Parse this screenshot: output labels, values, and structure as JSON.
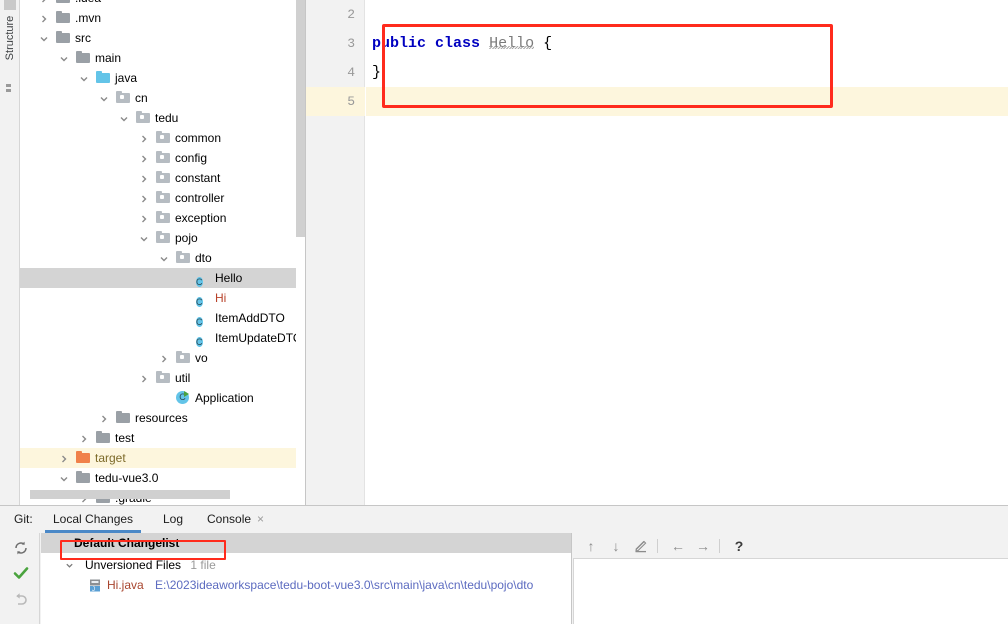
{
  "window": {
    "tool_strip_label": "Structure"
  },
  "project_tree": {
    "rows": [
      {
        "label": ".idea",
        "depth": 1,
        "arrow": "right",
        "icon": "folder",
        "color": "",
        "state": "normal"
      },
      {
        "label": ".mvn",
        "depth": 1,
        "arrow": "right",
        "icon": "folder",
        "color": "",
        "state": "normal"
      },
      {
        "label": "src",
        "depth": 1,
        "arrow": "down",
        "icon": "folder",
        "color": "",
        "state": "normal"
      },
      {
        "label": "main",
        "depth": 2,
        "arrow": "down",
        "icon": "folder",
        "color": "",
        "state": "normal"
      },
      {
        "label": "java",
        "depth": 3,
        "arrow": "down",
        "icon": "folder-blue",
        "color": "",
        "state": "normal"
      },
      {
        "label": "cn",
        "depth": 4,
        "arrow": "down",
        "icon": "package",
        "color": "",
        "state": "normal"
      },
      {
        "label": "tedu",
        "depth": 5,
        "arrow": "down",
        "icon": "package",
        "color": "",
        "state": "normal"
      },
      {
        "label": "common",
        "depth": 6,
        "arrow": "right",
        "icon": "package",
        "color": "",
        "state": "normal"
      },
      {
        "label": "config",
        "depth": 6,
        "arrow": "right",
        "icon": "package",
        "color": "",
        "state": "normal"
      },
      {
        "label": "constant",
        "depth": 6,
        "arrow": "right",
        "icon": "package",
        "color": "",
        "state": "normal"
      },
      {
        "label": "controller",
        "depth": 6,
        "arrow": "right",
        "icon": "package",
        "color": "",
        "state": "normal"
      },
      {
        "label": "exception",
        "depth": 6,
        "arrow": "right",
        "icon": "package",
        "color": "",
        "state": "normal"
      },
      {
        "label": "pojo",
        "depth": 6,
        "arrow": "down",
        "icon": "package",
        "color": "",
        "state": "normal"
      },
      {
        "label": "dto",
        "depth": 7,
        "arrow": "down",
        "icon": "package",
        "color": "",
        "state": "normal"
      },
      {
        "label": "Hello",
        "depth": 8,
        "arrow": "",
        "icon": "class",
        "color": "",
        "state": "selected"
      },
      {
        "label": "Hi",
        "depth": 8,
        "arrow": "",
        "icon": "class",
        "color": "red",
        "state": "normal"
      },
      {
        "label": "ItemAddDTO",
        "depth": 8,
        "arrow": "",
        "icon": "class",
        "color": "",
        "state": "normal"
      },
      {
        "label": "ItemUpdateDTO",
        "depth": 8,
        "arrow": "",
        "icon": "class",
        "color": "",
        "state": "normal"
      },
      {
        "label": "vo",
        "depth": 7,
        "arrow": "right",
        "icon": "package",
        "color": "",
        "state": "normal"
      },
      {
        "label": "util",
        "depth": 6,
        "arrow": "right",
        "icon": "package",
        "color": "",
        "state": "normal"
      },
      {
        "label": "Application",
        "depth": 7,
        "arrow": "",
        "icon": "application",
        "color": "",
        "state": "normal"
      },
      {
        "label": "resources",
        "depth": 4,
        "arrow": "right",
        "icon": "folder-res",
        "color": "",
        "state": "normal"
      },
      {
        "label": "test",
        "depth": 3,
        "arrow": "right",
        "icon": "folder",
        "color": "",
        "state": "normal"
      },
      {
        "label": "target",
        "depth": 2,
        "arrow": "right",
        "icon": "folder-orange",
        "color": "orange",
        "state": "highlight"
      },
      {
        "label": "tedu-vue3.0",
        "depth": 2,
        "arrow": "down",
        "icon": "folder",
        "color": "",
        "state": "normal"
      },
      {
        "label": ".gradle",
        "depth": 3,
        "arrow": "right",
        "icon": "folder",
        "color": "",
        "state": "normal"
      }
    ]
  },
  "editor": {
    "line_numbers": [
      "2",
      "3",
      "4",
      "5"
    ],
    "highlighted_line": "5",
    "code_lines": [
      {
        "line": "2",
        "tokens": []
      },
      {
        "line": "3",
        "tokens": [
          {
            "text": "public",
            "type": "keyword"
          },
          {
            "text": " ",
            "type": "plain"
          },
          {
            "text": "class",
            "type": "keyword"
          },
          {
            "text": " ",
            "type": "plain"
          },
          {
            "text": "Hello",
            "type": "classname"
          },
          {
            "text": " {",
            "type": "plain"
          }
        ]
      },
      {
        "line": "4",
        "tokens": [
          {
            "text": "}",
            "type": "plain"
          }
        ]
      },
      {
        "line": "5",
        "tokens": []
      }
    ],
    "annotation_color": "#ff2b1d"
  },
  "bottom_panel": {
    "tabs": [
      {
        "label": "Git:",
        "active": false,
        "closable": false
      },
      {
        "label": "Local Changes",
        "active": true,
        "closable": false
      },
      {
        "label": "Log",
        "active": false,
        "closable": false
      },
      {
        "label": "Console",
        "active": false,
        "closable": true
      }
    ],
    "close_glyph": "×",
    "vcs_actions": [
      {
        "name": "refresh-icon",
        "glyph": "↻"
      },
      {
        "name": "commit-check-icon",
        "glyph": "✓"
      },
      {
        "name": "rollback-icon",
        "glyph": "↶"
      }
    ],
    "changelist": {
      "title": "Default Changelist",
      "groups": [
        {
          "label": "Unversioned Files",
          "count": "1 file",
          "expanded": true,
          "files": [
            {
              "name": "Hi.java",
              "path": "E:\\2023ideaworkspace\\tedu-boot-vue3.0\\src\\main\\java\\cn\\tedu\\pojo\\dto"
            }
          ]
        }
      ]
    },
    "detail_toolbar": [
      {
        "name": "previous-difference-icon",
        "glyph": "↑"
      },
      {
        "name": "next-difference-icon",
        "glyph": "↓"
      },
      {
        "name": "edit-icon",
        "glyph": "✎"
      },
      {
        "name": "separator",
        "glyph": ""
      },
      {
        "name": "previous-change-icon",
        "glyph": "←"
      },
      {
        "name": "next-change-icon",
        "glyph": "→"
      },
      {
        "name": "separator",
        "glyph": ""
      },
      {
        "name": "help-icon",
        "glyph": "?"
      }
    ]
  }
}
